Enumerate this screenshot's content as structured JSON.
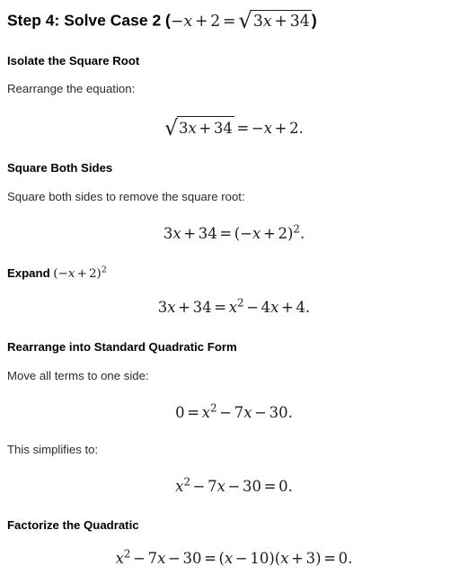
{
  "document": {
    "title_prefix": "Step 4: Solve Case 2 (",
    "title_suffix": ")",
    "title_math": {
      "lhs_neg": "−",
      "lhs_var": "x",
      "plus": "+",
      "lhs_const": "2",
      "equals": "=",
      "radicand_coeff": "3",
      "radicand_var": "x",
      "radicand_plus": "+",
      "radicand_const": "34"
    },
    "sections": [
      {
        "heading": "Isolate the Square Root",
        "paragraph": "Rearrange the equation:",
        "equation": "√(3x + 34) = −x + 2."
      },
      {
        "heading": "Square Both Sides",
        "paragraph": "Square both sides to remove the square root:",
        "equation": "3x + 34 = (−x + 2)²."
      },
      {
        "heading_prefix": "Expand ",
        "heading_math": "(−x + 2)²",
        "equation": "3x + 34 = x² − 4x + 4."
      },
      {
        "heading": "Rearrange into Standard Quadratic Form",
        "paragraph": "Move all terms to one side:",
        "equation": "0 = x² − 7x − 30.",
        "paragraph2": "This simplifies to:",
        "equation2": "x² − 7x − 30 = 0."
      },
      {
        "heading": "Factorize the Quadratic",
        "equation": "x² − 7x − 30 = (x − 10)(x + 3) = 0."
      }
    ],
    "symbols": {
      "minus": "−",
      "plus": "+",
      "equals": "=",
      "radical": "√",
      "period": ".",
      "lparen": "(",
      "rparen": ")",
      "exp_two": "2",
      "x": "x",
      "n0": "0",
      "n2": "2",
      "n3": "3",
      "n4": "4",
      "n7": "7",
      "n10": "10",
      "n30": "30",
      "n34": "34"
    },
    "colors": {
      "background": "#ffffff",
      "heading": "#000000",
      "body": "#2b2b2b",
      "math": "#1c1c1c"
    }
  }
}
